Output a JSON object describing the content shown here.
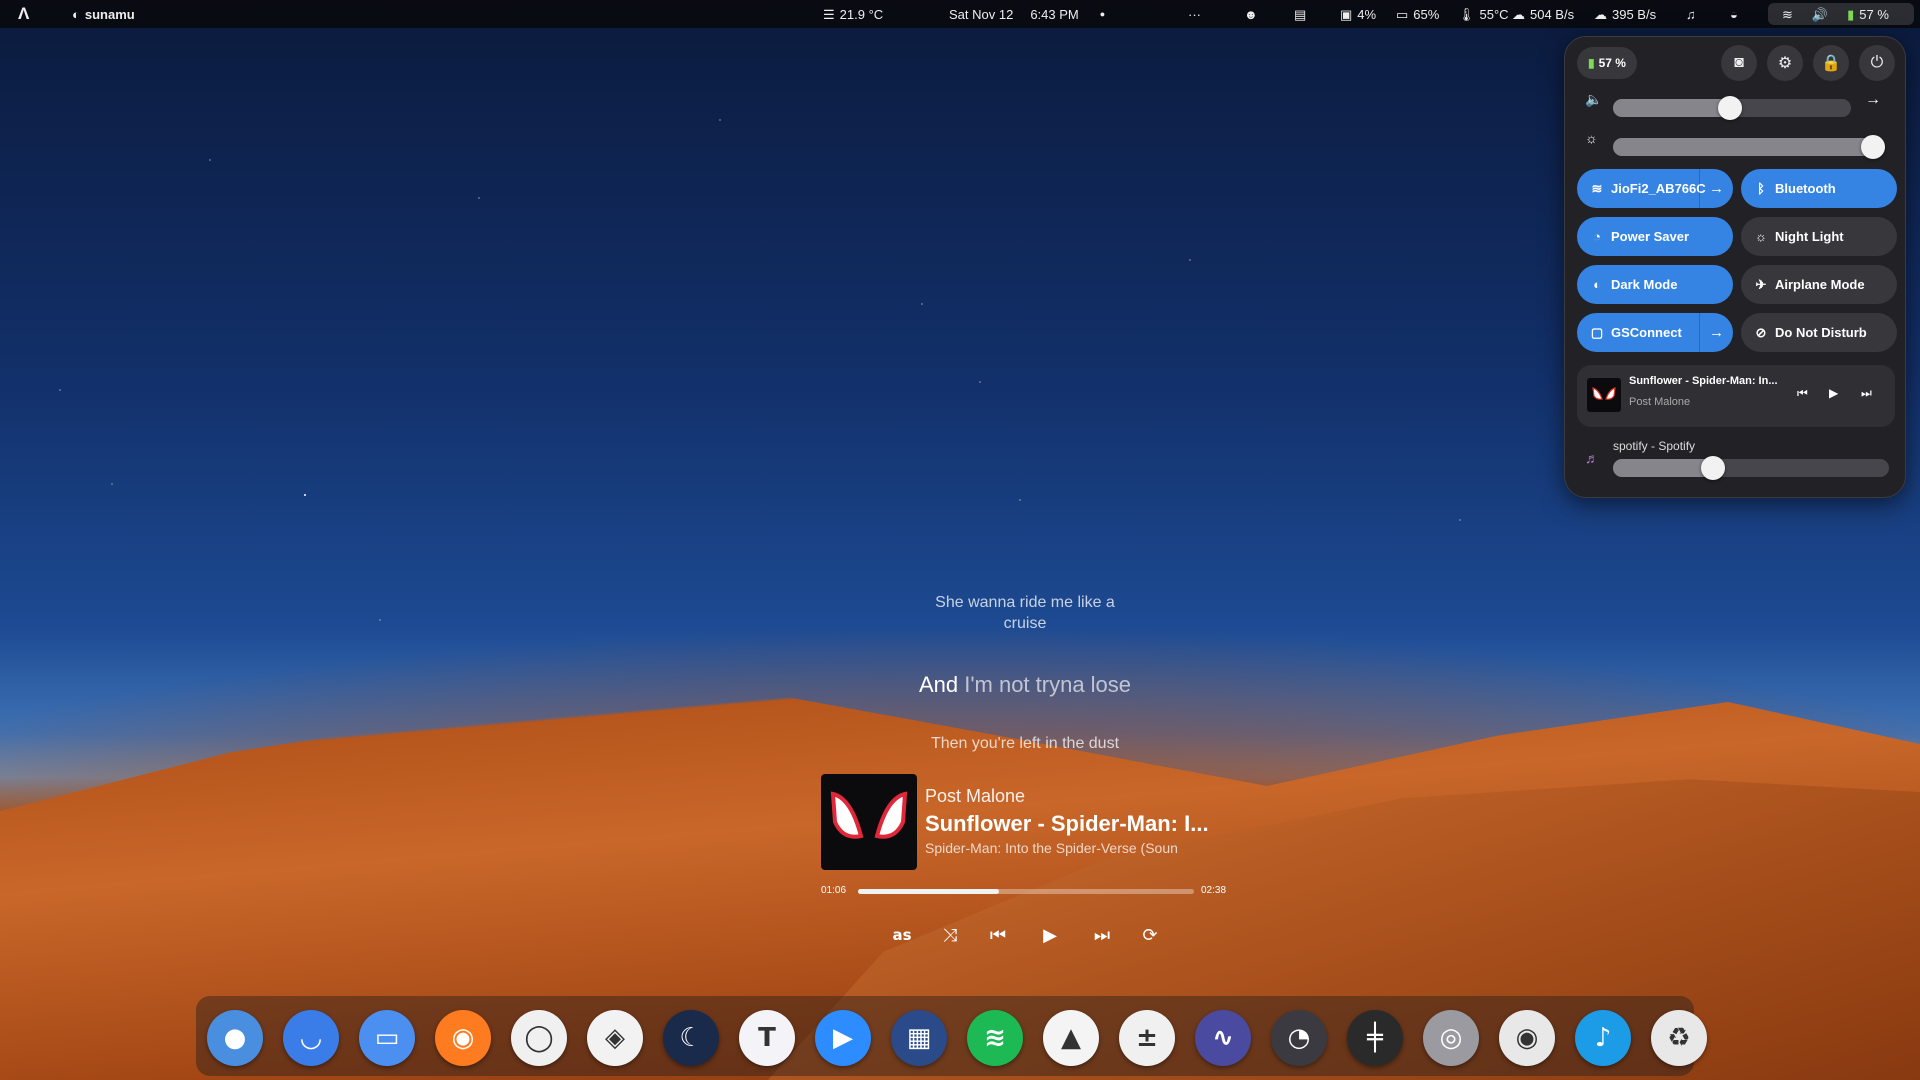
{
  "topbar": {
    "username": "sunamu",
    "weather": "21.9 °C",
    "date": "Sat Nov 12",
    "time": "6:43 PM",
    "dot": "●",
    "more": "···",
    "disk": "4%",
    "mem": "65%",
    "temp": "55°C",
    "download": "504 B/s",
    "upload": "395 B/s",
    "battery": "57 %"
  },
  "quick_settings": {
    "battery": "57 %",
    "volume_level": 0.49,
    "brightness_level": 1.0,
    "toggles": [
      {
        "label": "JioFi2_AB766C",
        "icon": "wifi-icon",
        "glyph": "≋",
        "on": true,
        "arrow": true
      },
      {
        "label": "Bluetooth",
        "icon": "bluetooth-icon",
        "glyph": "ᛒ",
        "on": true,
        "arrow": false
      },
      {
        "label": "Power Saver",
        "icon": "power-saver-icon",
        "glyph": "◔",
        "on": true,
        "arrow": false
      },
      {
        "label": "Night Light",
        "icon": "night-light-icon",
        "glyph": "☼",
        "on": false,
        "arrow": false
      },
      {
        "label": "Dark Mode",
        "icon": "dark-mode-icon",
        "glyph": "◐",
        "on": true,
        "arrow": false
      },
      {
        "label": "Airplane Mode",
        "icon": "airplane-icon",
        "glyph": "✈",
        "on": false,
        "arrow": false
      },
      {
        "label": "GSConnect",
        "icon": "gsconnect-icon",
        "glyph": "▢",
        "on": true,
        "arrow": true
      },
      {
        "label": "Do Not Disturb",
        "icon": "do-not-disturb-icon",
        "glyph": "⊘",
        "on": false,
        "arrow": false
      }
    ],
    "media": {
      "title": "Sunflower - Spider-Man: In...",
      "artist": "Post Malone"
    },
    "app_volume": {
      "label": "spotify - Spotify",
      "level": 0.35
    }
  },
  "lyrics": {
    "previous": "She wanna ride me like a\ncruise",
    "current_sung": "And",
    "current_rest": " I'm not tryna lose",
    "next": "Then you're left in the dust"
  },
  "player": {
    "artist": "Post Malone",
    "title": "Sunflower - Spider-Man: I...",
    "album": "Spider-Man: Into the Spider-Verse (Soun",
    "elapsed": "01:06",
    "duration": "02:38",
    "progress": 0.42
  },
  "dock": [
    {
      "name": "toggle-app-icon",
      "glyph": "●",
      "bg": "#4a8ee0"
    },
    {
      "name": "mail-app-icon",
      "glyph": "◡",
      "bg": "#3b7de8"
    },
    {
      "name": "files-app-icon",
      "glyph": "▭",
      "bg": "#4b8ff0"
    },
    {
      "name": "firefox-icon",
      "glyph": "◉",
      "bg": "#ff7b20"
    },
    {
      "name": "notes-app-icon",
      "glyph": "◯",
      "bg": "#f0f0f0"
    },
    {
      "name": "layers-app-icon",
      "glyph": "◈",
      "bg": "#f2f2f2"
    },
    {
      "name": "edge-app-icon",
      "glyph": "☾",
      "bg": "#1a2a4a"
    },
    {
      "name": "teams-app-icon",
      "glyph": "T",
      "bg": "#f4f4f8"
    },
    {
      "name": "zoom-app-icon",
      "glyph": "▶",
      "bg": "#2d8cff"
    },
    {
      "name": "pixel-app-icon",
      "glyph": "▦",
      "bg": "#2a4a8a"
    },
    {
      "name": "spotify-icon",
      "glyph": "≋",
      "bg": "#1db954"
    },
    {
      "name": "inkscape-icon",
      "glyph": "▲",
      "bg": "#f4f4f4"
    },
    {
      "name": "calculator-app-icon",
      "glyph": "±",
      "bg": "#f0f0f0"
    },
    {
      "name": "audio-app-icon",
      "glyph": "∿",
      "bg": "#4a4aa0"
    },
    {
      "name": "usage-app-icon",
      "glyph": "◔",
      "bg": "#3a3a40"
    },
    {
      "name": "mixer-app-icon",
      "glyph": "╪",
      "bg": "#2a2a2a"
    },
    {
      "name": "disk-app-icon",
      "glyph": "◎",
      "bg": "#9a9aa0"
    },
    {
      "name": "recorder-app-icon",
      "glyph": "◉",
      "bg": "#e8e8e8"
    },
    {
      "name": "music-app-icon",
      "glyph": "♪",
      "bg": "#1c9be6"
    },
    {
      "name": "trash-icon",
      "glyph": "♻",
      "bg": "#e8e8e8"
    }
  ],
  "colors": {
    "accent": "#3584e4",
    "panel": "#222226"
  }
}
